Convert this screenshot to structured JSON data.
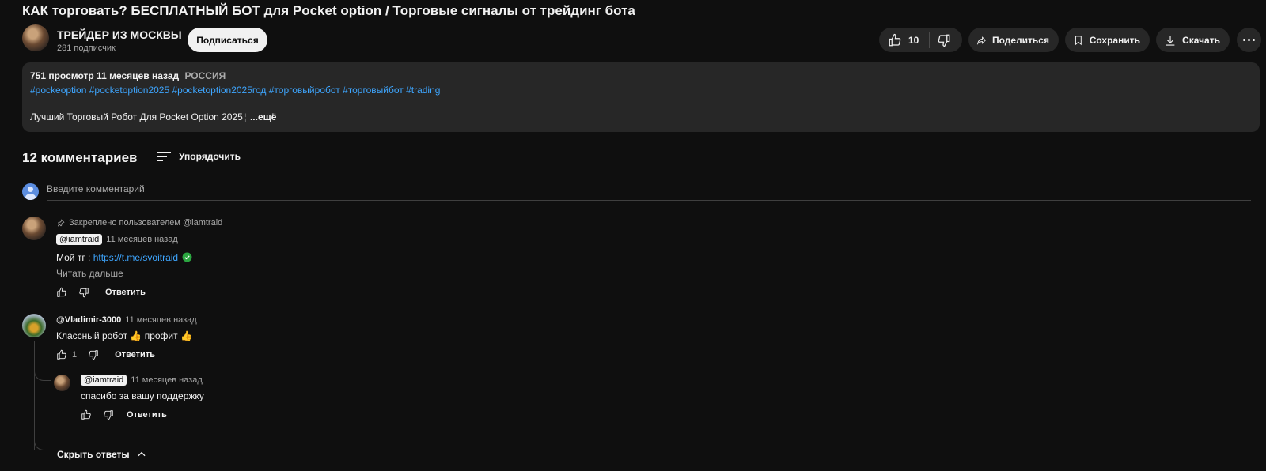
{
  "video": {
    "title": "КАК торговать? БЕСПЛАТНЫЙ БОТ для Pocket option / Торговые сигналы от трейдинг бота"
  },
  "channel": {
    "name": "ТРЕЙДЕР ИЗ МОСКВЫ",
    "subscribers": "281 подписчик",
    "subscribe_label": "Подписаться"
  },
  "actions": {
    "likes": "10",
    "share_label": "Поделиться",
    "save_label": "Сохранить",
    "download_label": "Скачать"
  },
  "description": {
    "views": "751 просмотр",
    "published": "11 месяцев назад",
    "country": "РОССИЯ",
    "tags": "#pockeoption #pocketoption2025 #pocketoption2025год #торговыйробот #торговыйбот #trading",
    "line": "Лучший Торговый Робот Для Pocket Option 2025",
    "more_label": "...ещё"
  },
  "comments": {
    "count_label": "12 комментариев",
    "sort_label": "Упорядочить",
    "input_placeholder": "Введите комментарий",
    "reply_label": "Ответить",
    "pinned": {
      "pinned_label": "Закреплено пользователем @iamtraid",
      "author": "@iamtraid",
      "time": "11 месяцев назад",
      "text_prefix": "Мой тг : ",
      "link": "https://t.me/svoitraid",
      "read_more": "Читать дальше"
    },
    "second": {
      "author": "@Vladimir-3000",
      "time": "11 месяцев назад",
      "text": "Классный робот 👍 профит 👍",
      "likes": "1"
    },
    "reply": {
      "author": "@iamtraid",
      "time": "11 месяцев назад",
      "text": "спасибо за вашу поддержку"
    },
    "hide_replies_label": "Скрыть ответы"
  }
}
